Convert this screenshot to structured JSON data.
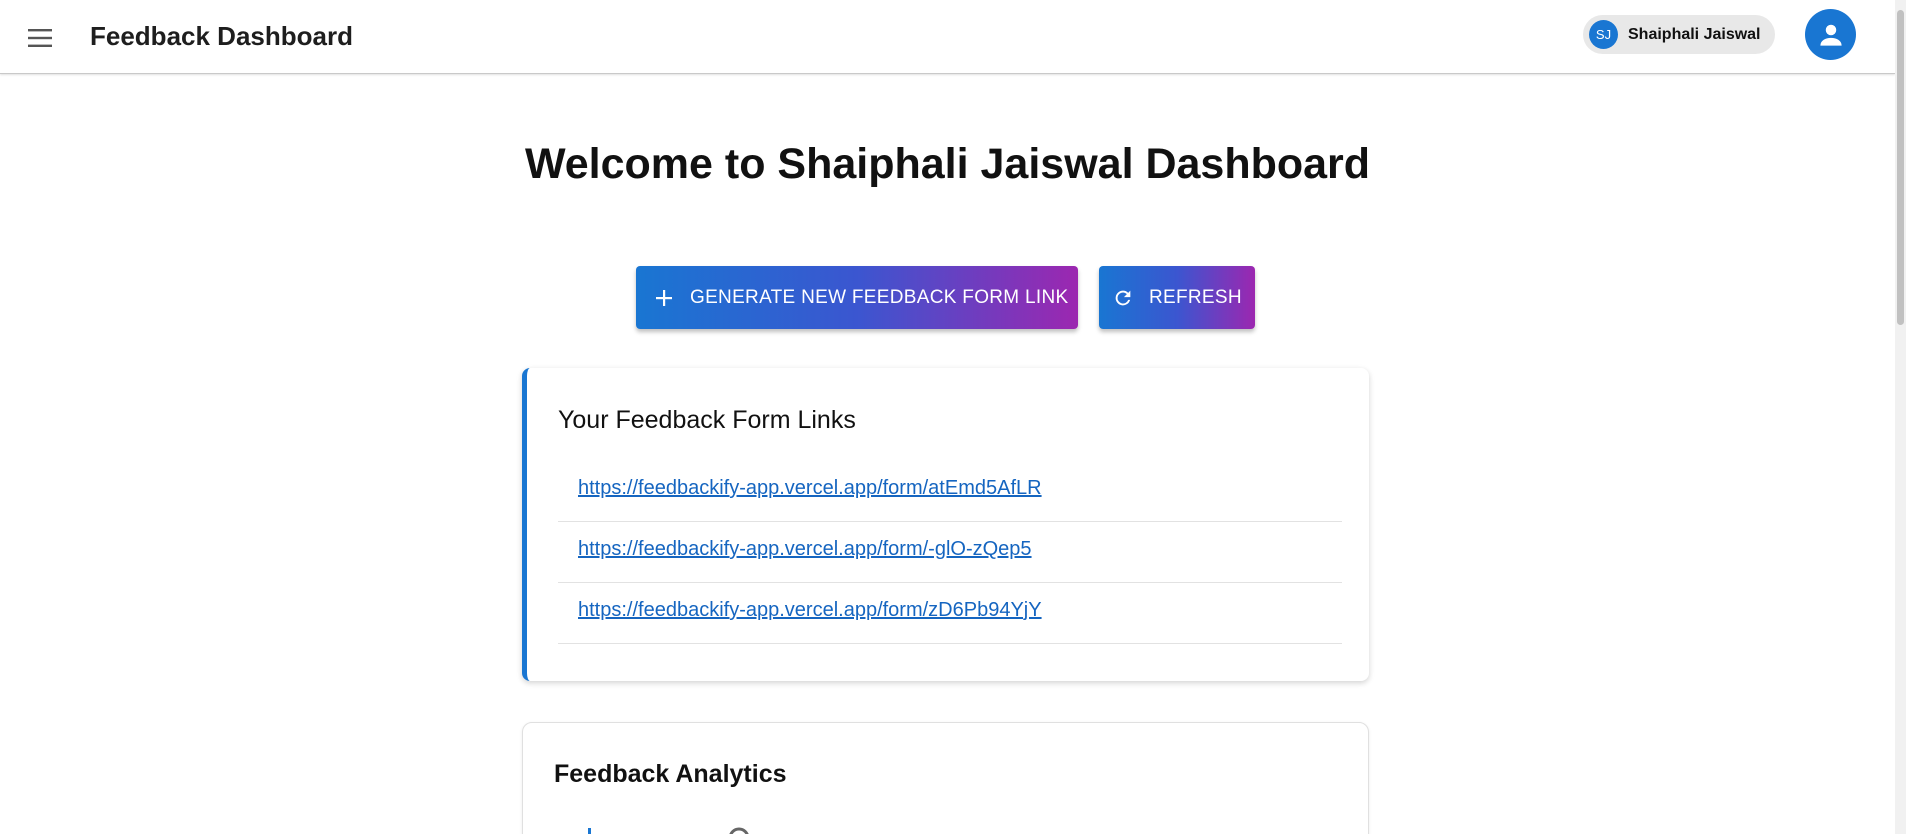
{
  "header": {
    "title": "Feedback Dashboard",
    "user_chip_initials": "SJ",
    "user_chip_name": "Shaiphali Jaiswal"
  },
  "main": {
    "welcome_text": "Welcome to Shaiphali Jaiswal Dashboard",
    "generate_button_label": "GENERATE NEW FEEDBACK FORM LINK",
    "refresh_button_label": "REFRESH"
  },
  "links_card": {
    "title": "Your Feedback Form Links",
    "links": [
      "https://feedbackify-app.vercel.app/form/atEmd5AfLR",
      "https://feedbackify-app.vercel.app/form/-glO-zQep5",
      "https://feedbackify-app.vercel.app/form/zD6Pb94YjY"
    ]
  },
  "analytics_card": {
    "title": "Feedback Analytics"
  },
  "icons": {
    "menu": "menu-icon",
    "account": "account-circle-icon",
    "add": "add-icon",
    "refresh": "refresh-icon"
  },
  "colors": {
    "primary": "#1976d2",
    "gradient_end": "#9c27b0",
    "link": "#1565c0"
  }
}
